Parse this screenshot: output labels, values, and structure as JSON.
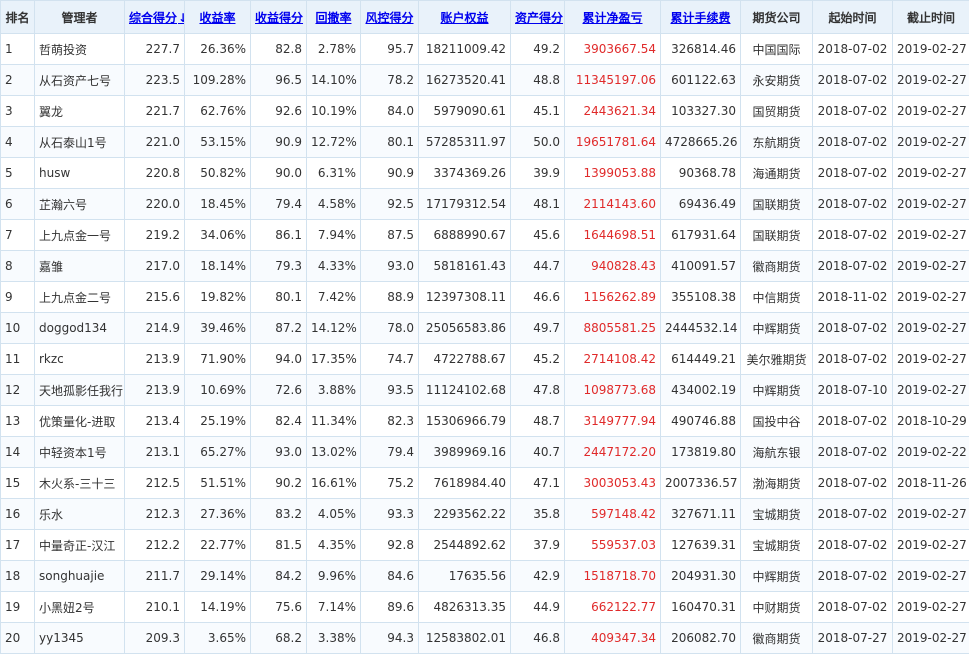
{
  "headers": [
    {
      "label": "排名",
      "sortable": false
    },
    {
      "label": "管理者",
      "sortable": false
    },
    {
      "label": "综合得分",
      "sortable": true,
      "arrow": "↓"
    },
    {
      "label": "收益率",
      "sortable": true
    },
    {
      "label": "收益得分",
      "sortable": true
    },
    {
      "label": "回撤率",
      "sortable": true
    },
    {
      "label": "风控得分",
      "sortable": true
    },
    {
      "label": "账户权益",
      "sortable": true
    },
    {
      "label": "资产得分",
      "sortable": true
    },
    {
      "label": "累计净盈亏",
      "sortable": true
    },
    {
      "label": "累计手续费",
      "sortable": true
    },
    {
      "label": "期货公司",
      "sortable": false
    },
    {
      "label": "起始时间",
      "sortable": false
    },
    {
      "label": "截止时间",
      "sortable": false
    }
  ],
  "colors": {
    "profit": "#e02a2a",
    "link": "#0000ee",
    "header_bg": "#e9f2fa",
    "border": "#d2e2ef"
  },
  "rows": [
    [
      "1",
      "哲萌投资",
      "227.7",
      "26.36%",
      "82.8",
      "2.78%",
      "95.7",
      "18211009.42",
      "49.2",
      "3903667.54",
      "326814.46",
      "中国国际",
      "2018-07-02",
      "2019-02-27"
    ],
    [
      "2",
      "从石资产七号",
      "223.5",
      "109.28%",
      "96.5",
      "14.10%",
      "78.2",
      "16273520.41",
      "48.8",
      "11345197.06",
      "601122.63",
      "永安期货",
      "2018-07-02",
      "2019-02-27"
    ],
    [
      "3",
      "翼龙",
      "221.7",
      "62.76%",
      "92.6",
      "10.19%",
      "84.0",
      "5979090.61",
      "45.1",
      "2443621.34",
      "103327.30",
      "国贸期货",
      "2018-07-02",
      "2019-02-27"
    ],
    [
      "4",
      "从石泰山1号",
      "221.0",
      "53.15%",
      "90.9",
      "12.72%",
      "80.1",
      "57285311.97",
      "50.0",
      "19651781.64",
      "4728665.26",
      "东航期货",
      "2018-07-02",
      "2019-02-27"
    ],
    [
      "5",
      "husw",
      "220.8",
      "50.82%",
      "90.0",
      "6.31%",
      "90.9",
      "3374369.26",
      "39.9",
      "1399053.88",
      "90368.78",
      "海通期货",
      "2018-07-02",
      "2019-02-27"
    ],
    [
      "6",
      "芷瀚六号",
      "220.0",
      "18.45%",
      "79.4",
      "4.58%",
      "92.5",
      "17179312.54",
      "48.1",
      "2114143.60",
      "69436.49",
      "国联期货",
      "2018-07-02",
      "2019-02-27"
    ],
    [
      "7",
      "上九点金一号",
      "219.2",
      "34.06%",
      "86.1",
      "7.94%",
      "87.5",
      "6888990.67",
      "45.6",
      "1644698.51",
      "617931.64",
      "国联期货",
      "2018-07-02",
      "2019-02-27"
    ],
    [
      "8",
      "嘉雏",
      "217.0",
      "18.14%",
      "79.3",
      "4.33%",
      "93.0",
      "5818161.43",
      "44.7",
      "940828.43",
      "410091.57",
      "徽商期货",
      "2018-07-02",
      "2019-02-27"
    ],
    [
      "9",
      "上九点金二号",
      "215.6",
      "19.82%",
      "80.1",
      "7.42%",
      "88.9",
      "12397308.11",
      "46.6",
      "1156262.89",
      "355108.38",
      "中信期货",
      "2018-11-02",
      "2019-02-27"
    ],
    [
      "10",
      "doggod134",
      "214.9",
      "39.46%",
      "87.2",
      "14.12%",
      "78.0",
      "25056583.86",
      "49.7",
      "8805581.25",
      "2444532.14",
      "中辉期货",
      "2018-07-02",
      "2019-02-27"
    ],
    [
      "11",
      "rkzc",
      "213.9",
      "71.90%",
      "94.0",
      "17.35%",
      "74.7",
      "4722788.67",
      "45.2",
      "2714108.42",
      "614449.21",
      "美尔雅期货",
      "2018-07-02",
      "2019-02-27"
    ],
    [
      "12",
      "天地孤影任我行",
      "213.9",
      "10.69%",
      "72.6",
      "3.88%",
      "93.5",
      "11124102.68",
      "47.8",
      "1098773.68",
      "434002.19",
      "中辉期货",
      "2018-07-10",
      "2019-02-27"
    ],
    [
      "13",
      "优策量化-进取",
      "213.4",
      "25.19%",
      "82.4",
      "11.34%",
      "82.3",
      "15306966.79",
      "48.7",
      "3149777.94",
      "490746.88",
      "国投中谷",
      "2018-07-02",
      "2018-10-29"
    ],
    [
      "14",
      "中轻资本1号",
      "213.1",
      "65.27%",
      "93.0",
      "13.02%",
      "79.4",
      "3989969.16",
      "40.7",
      "2447172.20",
      "173819.80",
      "海航东银",
      "2018-07-02",
      "2019-02-22"
    ],
    [
      "15",
      "木火系-三十三",
      "212.5",
      "51.51%",
      "90.2",
      "16.61%",
      "75.2",
      "7618984.40",
      "47.1",
      "3003053.43",
      "2007336.57",
      "渤海期货",
      "2018-07-02",
      "2018-11-26"
    ],
    [
      "16",
      "乐水",
      "212.3",
      "27.36%",
      "83.2",
      "4.05%",
      "93.3",
      "2293562.22",
      "35.8",
      "597148.42",
      "327671.11",
      "宝城期货",
      "2018-07-02",
      "2019-02-27"
    ],
    [
      "17",
      "中量奇正-汉江",
      "212.2",
      "22.77%",
      "81.5",
      "4.35%",
      "92.8",
      "2544892.62",
      "37.9",
      "559537.03",
      "127639.31",
      "宝城期货",
      "2018-07-02",
      "2019-02-27"
    ],
    [
      "18",
      "songhuajie",
      "211.7",
      "29.14%",
      "84.2",
      "9.96%",
      "84.6",
      "17635.56",
      "42.9",
      "1518718.70",
      "204931.30",
      "中辉期货",
      "2018-07-02",
      "2019-02-27"
    ],
    [
      "19",
      "小黑妞2号",
      "210.1",
      "14.19%",
      "75.6",
      "7.14%",
      "89.6",
      "4826313.35",
      "44.9",
      "662122.77",
      "160470.31",
      "中财期货",
      "2018-07-02",
      "2019-02-27"
    ],
    [
      "20",
      "yy1345",
      "209.3",
      "3.65%",
      "68.2",
      "3.38%",
      "94.3",
      "12583802.01",
      "46.8",
      "409347.34",
      "206082.70",
      "徽商期货",
      "2018-07-27",
      "2019-02-27"
    ]
  ]
}
